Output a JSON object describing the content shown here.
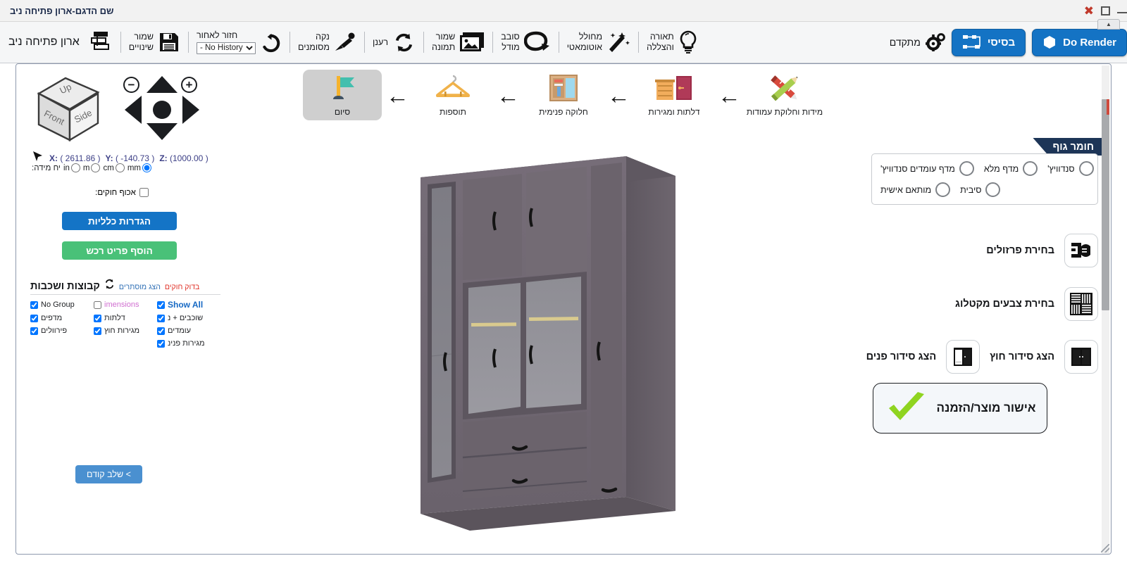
{
  "window": {
    "title": "שם הדגם-ארון פתיחה ניב",
    "close_label": "✖",
    "maximize_label": "",
    "minimize_label": ""
  },
  "toolbar": {
    "advanced_label": "מתקדם",
    "basic_button": "בסיסי",
    "render_button": "Do Render",
    "items": [
      {
        "name": "lighting-shading",
        "line1": "תאורה",
        "line2": "והצללה",
        "icon": "bulb-icon"
      },
      {
        "name": "auto-generator",
        "line1": "מחולל",
        "line2": "אוטומאטי",
        "icon": "magic-wand-icon"
      },
      {
        "name": "rotate-model",
        "line1": "סובב",
        "line2": "מודל",
        "icon": "rotate-arrow-icon"
      },
      {
        "name": "save-image",
        "line1": "שמור",
        "line2": "תמונה",
        "icon": "image-icon"
      },
      {
        "name": "refresh",
        "line1": "רענן",
        "line2": "",
        "icon": "refresh-icon"
      },
      {
        "name": "clear-marked",
        "line1": "נקה",
        "line2": "מסומנים",
        "icon": "brush-icon"
      },
      {
        "name": "undo",
        "line1": "חזור לאחור",
        "line2": "",
        "icon": "undo-icon"
      },
      {
        "name": "save-changes",
        "line1": "שמור",
        "line2": "שינויים",
        "icon": "floppy-icon"
      }
    ],
    "history_selected": "- No History",
    "brand_title": "ארון פתיחה ניב",
    "brand_icon": "layers-stack-icon"
  },
  "steps": [
    {
      "label": "סיום",
      "icon": "flag-icon",
      "active": true
    },
    {
      "label": "תוספות",
      "icon": "hanger-icon",
      "active": false
    },
    {
      "label": "חלוקה פנימית",
      "icon": "wardrobe-interior-icon",
      "active": false
    },
    {
      "label": "דלתות ומגירות",
      "icon": "doors-drawers-icon",
      "active": false
    },
    {
      "label": "מידות וחלוקת עמודות",
      "icon": "pencil-ruler-icon",
      "active": false
    }
  ],
  "step_arrow": "←",
  "viewcube": {
    "face_up": "Up",
    "face_front": "Front",
    "face_side": "Side"
  },
  "navpad": {
    "zoom_out": "−",
    "zoom_in": "+",
    "up": "▲",
    "down": "▼",
    "left": "◀",
    "right": "▶",
    "center": "●"
  },
  "coords": {
    "x_label": "X:",
    "x_value": "( 2611.86 )",
    "y_label": "Y:",
    "y_value": "( -140.73 )",
    "z_label": "Z:",
    "z_value": "(1000.00 )"
  },
  "units": {
    "label": "יח מידה:",
    "options": [
      {
        "name": "mm",
        "label": "mm",
        "selected": true
      },
      {
        "name": "cm",
        "label": "cm",
        "selected": false
      },
      {
        "name": "m",
        "label": "m",
        "selected": false
      },
      {
        "name": "in",
        "label": "in",
        "selected": false
      }
    ]
  },
  "snap": {
    "label": "אכוף חוקים:",
    "checked": false
  },
  "left_buttons": {
    "general_settings": "הגדרות כלליות",
    "add_part": "הוסף פריט רכש",
    "prev_step": "> שלב קודם"
  },
  "layers": {
    "title": "קבוצות ושכבות",
    "refresh_icon": "refresh-icon",
    "show_hidden": "הצג מוסתרים",
    "check_rules": "בדוק חוקים",
    "items": [
      {
        "label": "Show All",
        "checked": true,
        "style": "blue",
        "dir": "ltr"
      },
      {
        "label": "imensions",
        "checked": false,
        "style": "lilac",
        "dir": "ltr"
      },
      {
        "label": "No Group",
        "checked": true,
        "style": "eng",
        "dir": "ltr"
      },
      {
        "label": "שוכבים + נ",
        "checked": true,
        "style": "",
        "dir": "rtl"
      },
      {
        "label": "דלתות",
        "checked": true,
        "style": "",
        "dir": "rtl"
      },
      {
        "label": "מדפים",
        "checked": true,
        "style": "",
        "dir": "rtl"
      },
      {
        "label": "עומדים",
        "checked": true,
        "style": "",
        "dir": "rtl"
      },
      {
        "label": "מגירות חוץ",
        "checked": true,
        "style": "",
        "dir": "rtl"
      },
      {
        "label": "פירוולים",
        "checked": true,
        "style": "",
        "dir": "rtl"
      },
      {
        "label": "מגירות פנינ",
        "checked": true,
        "style": "",
        "dir": "rtl"
      }
    ]
  },
  "material": {
    "header": "חומר גוף",
    "options": [
      {
        "label": "סנדוויץ'",
        "selected": false
      },
      {
        "label": "מדף מלא",
        "selected": false
      },
      {
        "label": "מדף עומדים סנדוויץ'",
        "selected": false
      },
      {
        "label": "סיבית",
        "selected": false
      },
      {
        "label": "מותאם אישית",
        "selected": false
      }
    ]
  },
  "actions": [
    {
      "label": "בחירת פרזולים",
      "icon": "hardware-handle-icon"
    },
    {
      "label": "בחירת צבעים מקטלוג",
      "icon": "color-catalog-icon"
    }
  ],
  "view_buttons": [
    {
      "label": "הצג סידור חוץ",
      "icon": "wardrobe-closed-icon"
    },
    {
      "label": "הצג סידור פנים",
      "icon": "wardrobe-open-icon"
    }
  ],
  "confirm": {
    "label": "אישור מוצר/הזמנה",
    "icon": "green-check-icon",
    "color": "#8fd420"
  },
  "colors": {
    "primary_blue": "#1473c4",
    "green": "#49c178",
    "header_navy": "#1d3557",
    "accent_red": "#e03127",
    "check_green": "#8fd420",
    "model_body": "#6b626c",
    "model_glass": "#8d8b92"
  }
}
